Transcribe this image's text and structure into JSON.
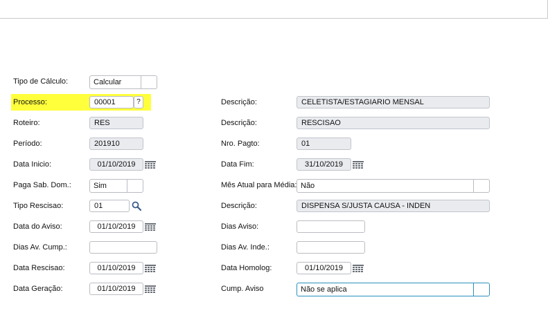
{
  "form": {
    "tipo_calculo": {
      "label": "Tipo de Cálculo:",
      "value": "Calcular"
    },
    "processo": {
      "label": "Processo:",
      "value": "00001",
      "help_button": "?"
    },
    "processo_descricao": {
      "label": "Descrição:",
      "value": "CELETISTA/ESTAGIARIO MENSAL"
    },
    "roteiro": {
      "label": "Roteiro:",
      "value": "RES"
    },
    "roteiro_descricao": {
      "label": "Descrição:",
      "value": "RESCISAO"
    },
    "periodo": {
      "label": "Período:",
      "value": "201910"
    },
    "nro_pagto": {
      "label": "Nro. Pagto:",
      "value": "01"
    },
    "data_inicio": {
      "label": "Data Inicio:",
      "value": "01/10/2019"
    },
    "data_fim": {
      "label": "Data Fim:",
      "value": "31/10/2019"
    },
    "paga_sab_dom": {
      "label": "Paga Sab. Dom.:",
      "value": "Sim"
    },
    "mes_atual_media": {
      "label": "Mês Atual para Média:",
      "value": "Não"
    },
    "tipo_rescisao": {
      "label": "Tipo Rescisao:",
      "value": "01"
    },
    "rescisao_descricao": {
      "label": "Descrição:",
      "value": "DISPENSA S/JUSTA CAUSA - INDEN"
    },
    "data_aviso": {
      "label": "Data do Aviso:",
      "value": "01/10/2019"
    },
    "dias_aviso": {
      "label": "Dias Aviso:",
      "value": ""
    },
    "dias_av_cump": {
      "label": "Dias Av. Cump.:",
      "value": ""
    },
    "dias_av_inde": {
      "label": "Dias Av. Inde.:",
      "value": ""
    },
    "data_rescisao": {
      "label": "Data Rescisao:",
      "value": "01/10/2019"
    },
    "data_homolog": {
      "label": "Data Homolog:",
      "value": "01/10/2019"
    },
    "data_geracao": {
      "label": "Data Geração:",
      "value": "01/10/2019"
    },
    "cump_aviso": {
      "label": "Cump. Aviso",
      "value": "Não se aplica"
    }
  },
  "colors": {
    "highlight": "#ffff3c",
    "readonly_bg": "#e9ebef",
    "focus_border": "#2a8fbd",
    "icon": "#6b7078"
  },
  "icons": {
    "calendar": "calendar-icon",
    "search": "search-icon"
  }
}
